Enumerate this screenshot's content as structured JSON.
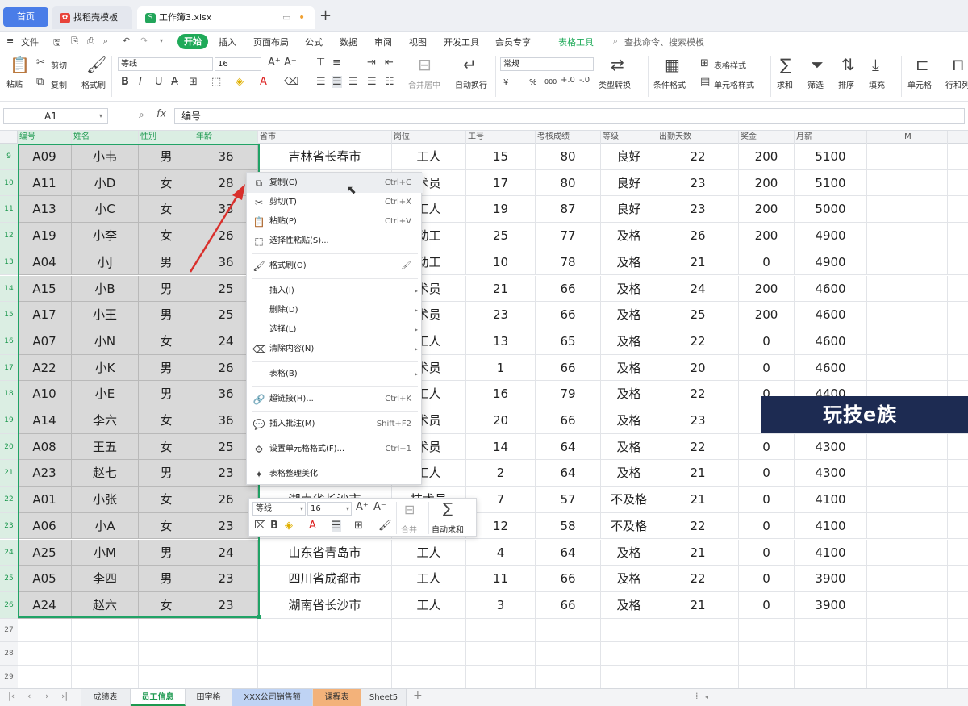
{
  "tabs": {
    "home": "首页",
    "template": "找稻壳模板",
    "file": "工作簿3.xlsx"
  },
  "menu": {
    "file": "文件",
    "items": [
      "开始",
      "插入",
      "页面布局",
      "公式",
      "数据",
      "审阅",
      "视图",
      "开发工具",
      "会员专享",
      "表格工具"
    ],
    "search": "查找命令、搜索模板"
  },
  "ribbon": {
    "paste": "粘贴",
    "cut": "剪切",
    "copy": "复制",
    "format_painter": "格式刷",
    "font_name": "等线",
    "font_size": "16",
    "merge_center": "合并居中",
    "wrap_text": "自动换行",
    "number_format": "常规",
    "convert_type": "类型转换",
    "cond_format": "条件格式",
    "table_style": "表格样式",
    "cell_style": "单元格样式",
    "sum": "求和",
    "filter": "筛选",
    "sort": "排序",
    "fill": "填充",
    "cell": "单元格",
    "row_col": "行和列",
    "currency": "¥",
    "percent": "%",
    "thousands": "000"
  },
  "formula_bar": {
    "cell_ref": "A1",
    "fx": "fx",
    "content": "编号"
  },
  "columns": [
    {
      "label": "编号",
      "w": 67,
      "sel": true
    },
    {
      "label": "姓名",
      "w": 83,
      "sel": true
    },
    {
      "label": "性别",
      "w": 69,
      "sel": true
    },
    {
      "label": "年龄",
      "w": 79,
      "sel": true
    },
    {
      "label": "省市",
      "w": 166
    },
    {
      "label": "岗位",
      "w": 92
    },
    {
      "label": "工号",
      "w": 86
    },
    {
      "label": "考核成绩",
      "w": 81
    },
    {
      "label": "等级",
      "w": 70
    },
    {
      "label": "出勤天数",
      "w": 101
    },
    {
      "label": "奖金",
      "w": 69
    },
    {
      "label": "月薪",
      "w": 90
    },
    {
      "label": "M",
      "w": 100
    },
    {
      "label": "",
      "w": 125
    }
  ],
  "rows": [
    {
      "n": "9",
      "c": [
        "A09",
        "小韦",
        "男",
        "36",
        "吉林省长春市",
        "工人",
        "15",
        "80",
        "良好",
        "22",
        "200",
        "5100"
      ]
    },
    {
      "n": "10",
      "c": [
        "A11",
        "小D",
        "女",
        "28",
        "",
        "术员",
        "17",
        "80",
        "良好",
        "23",
        "200",
        "5100"
      ]
    },
    {
      "n": "11",
      "c": [
        "A13",
        "小C",
        "女",
        "33",
        "",
        "工人",
        "19",
        "87",
        "良好",
        "23",
        "200",
        "5000"
      ]
    },
    {
      "n": "12",
      "c": [
        "A19",
        "小李",
        "女",
        "26",
        "",
        "动工",
        "25",
        "77",
        "及格",
        "26",
        "200",
        "4900"
      ]
    },
    {
      "n": "13",
      "c": [
        "A04",
        "小J",
        "男",
        "36",
        "",
        "动工",
        "10",
        "78",
        "及格",
        "21",
        "0",
        "4900"
      ]
    },
    {
      "n": "14",
      "c": [
        "A15",
        "小B",
        "男",
        "25",
        "",
        "术员",
        "21",
        "66",
        "及格",
        "24",
        "200",
        "4600"
      ]
    },
    {
      "n": "15",
      "c": [
        "A17",
        "小王",
        "男",
        "25",
        "",
        "术员",
        "23",
        "66",
        "及格",
        "25",
        "200",
        "4600"
      ]
    },
    {
      "n": "16",
      "c": [
        "A07",
        "小N",
        "女",
        "24",
        "",
        "工人",
        "13",
        "65",
        "及格",
        "22",
        "0",
        "4600"
      ]
    },
    {
      "n": "17",
      "c": [
        "A22",
        "小K",
        "男",
        "26",
        "",
        "术员",
        "1",
        "66",
        "及格",
        "20",
        "0",
        "4600"
      ]
    },
    {
      "n": "18",
      "c": [
        "A10",
        "小E",
        "男",
        "36",
        "",
        "工人",
        "16",
        "79",
        "及格",
        "22",
        "0",
        "4400"
      ]
    },
    {
      "n": "19",
      "c": [
        "A14",
        "李六",
        "女",
        "36",
        "",
        "术员",
        "20",
        "66",
        "及格",
        "23",
        "2",
        ""
      ]
    },
    {
      "n": "20",
      "c": [
        "A08",
        "王五",
        "女",
        "25",
        "",
        "术员",
        "14",
        "64",
        "及格",
        "22",
        "0",
        "4300"
      ]
    },
    {
      "n": "21",
      "c": [
        "A23",
        "赵七",
        "男",
        "23",
        "",
        "工人",
        "2",
        "64",
        "及格",
        "21",
        "0",
        "4300"
      ]
    },
    {
      "n": "22",
      "c": [
        "A01",
        "小张",
        "女",
        "26",
        "湖南省长沙市",
        "技术员",
        "7",
        "57",
        "不及格",
        "21",
        "0",
        "4100"
      ]
    },
    {
      "n": "23",
      "c": [
        "A06",
        "小A",
        "女",
        "23",
        "",
        "",
        "12",
        "58",
        "不及格",
        "22",
        "0",
        "4100"
      ]
    },
    {
      "n": "24",
      "c": [
        "A25",
        "小M",
        "男",
        "24",
        "山东省青岛市",
        "工人",
        "4",
        "64",
        "及格",
        "21",
        "0",
        "4100"
      ]
    },
    {
      "n": "25",
      "c": [
        "A05",
        "李四",
        "男",
        "23",
        "四川省成都市",
        "工人",
        "11",
        "66",
        "及格",
        "22",
        "0",
        "3900"
      ]
    },
    {
      "n": "26",
      "c": [
        "A24",
        "赵六",
        "女",
        "23",
        "湖南省长沙市",
        "工人",
        "3",
        "66",
        "及格",
        "21",
        "0",
        "3900"
      ]
    }
  ],
  "empty_rows": [
    "27",
    "28",
    "29"
  ],
  "context_menu": [
    {
      "icon": "⧉",
      "icon_name": "copy-icon",
      "label": "复制(C)",
      "key": "Ctrl+C",
      "hl": true
    },
    {
      "icon": "✂",
      "icon_name": "cut-icon",
      "label": "剪切(T)",
      "key": "Ctrl+X"
    },
    {
      "icon": "📋",
      "icon_name": "paste-icon",
      "label": "粘贴(P)",
      "key": "Ctrl+V"
    },
    {
      "icon": "⬚",
      "icon_name": "paste-special-icon",
      "label": "选择性粘贴(S)...",
      "key": "",
      "sep_after": true
    },
    {
      "icon": "🖌",
      "icon_name": "format-painter-icon",
      "label": "格式刷(O)",
      "key": "",
      "extra": "🖌",
      "sep_after": true
    },
    {
      "icon": "",
      "icon_name": "",
      "label": "插入(I)",
      "key": "",
      "arrow": true
    },
    {
      "icon": "",
      "icon_name": "",
      "label": "删除(D)",
      "key": "",
      "arrow": true
    },
    {
      "icon": "",
      "icon_name": "",
      "label": "选择(L)",
      "key": "",
      "arrow": true
    },
    {
      "icon": "⌫",
      "icon_name": "clear-content-icon",
      "label": "清除内容(N)",
      "key": "",
      "arrow": true,
      "sep_after": true
    },
    {
      "icon": "",
      "icon_name": "",
      "label": "表格(B)",
      "key": "",
      "arrow": true,
      "sep_after": true
    },
    {
      "icon": "🔗",
      "icon_name": "hyperlink-icon",
      "label": "超链接(H)...",
      "key": "Ctrl+K",
      "sep_after": true
    },
    {
      "icon": "💬",
      "icon_name": "insert-comment-icon",
      "label": "插入批注(M)",
      "key": "Shift+F2",
      "sep_after": true
    },
    {
      "icon": "⚙",
      "icon_name": "cell-format-icon",
      "label": "设置单元格格式(F)...",
      "key": "Ctrl+1",
      "sep_after": true
    },
    {
      "icon": "✦",
      "icon_name": "beautify-icon",
      "label": "表格整理美化",
      "key": ""
    }
  ],
  "mini_toolbar": {
    "font_name": "等线",
    "font_size": "16",
    "merge": "合并",
    "autosum": "自动求和"
  },
  "watermark": "玩技e族",
  "sheets": [
    {
      "name": "成绩表",
      "style": ""
    },
    {
      "name": "员工信息",
      "style": "active"
    },
    {
      "name": "田字格",
      "style": ""
    },
    {
      "name": "XXX公司销售额",
      "style": "blue"
    },
    {
      "name": "课程表",
      "style": "orange"
    },
    {
      "name": "Sheet5",
      "style": ""
    }
  ],
  "colors": {
    "accent": "#1faa59",
    "selection_fill": "#d9d9d9",
    "tab_home": "#4a7de8",
    "annotation_arrow": "#d9302c"
  }
}
